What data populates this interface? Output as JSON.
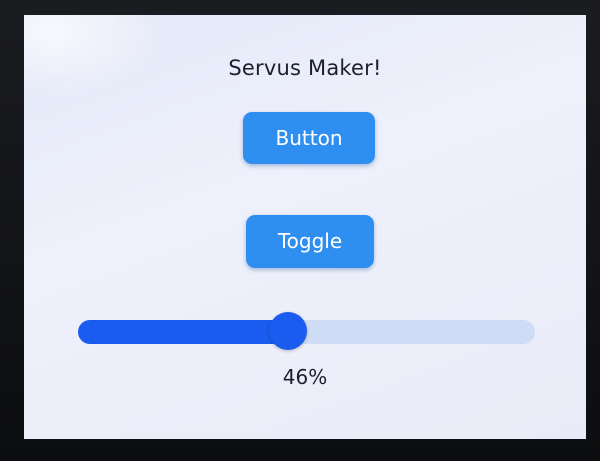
{
  "screen": {
    "title": "Servus Maker!",
    "button_label": "Button",
    "toggle_label": "Toggle",
    "slider": {
      "value": 46,
      "value_label": "46%"
    }
  },
  "colors": {
    "screen_bg": "#e9ecf8",
    "button": "#2f8ff0",
    "slider_active": "#1a5cf0",
    "slider_inactive": "#cfdcf5",
    "text": "#1d1f2e"
  }
}
